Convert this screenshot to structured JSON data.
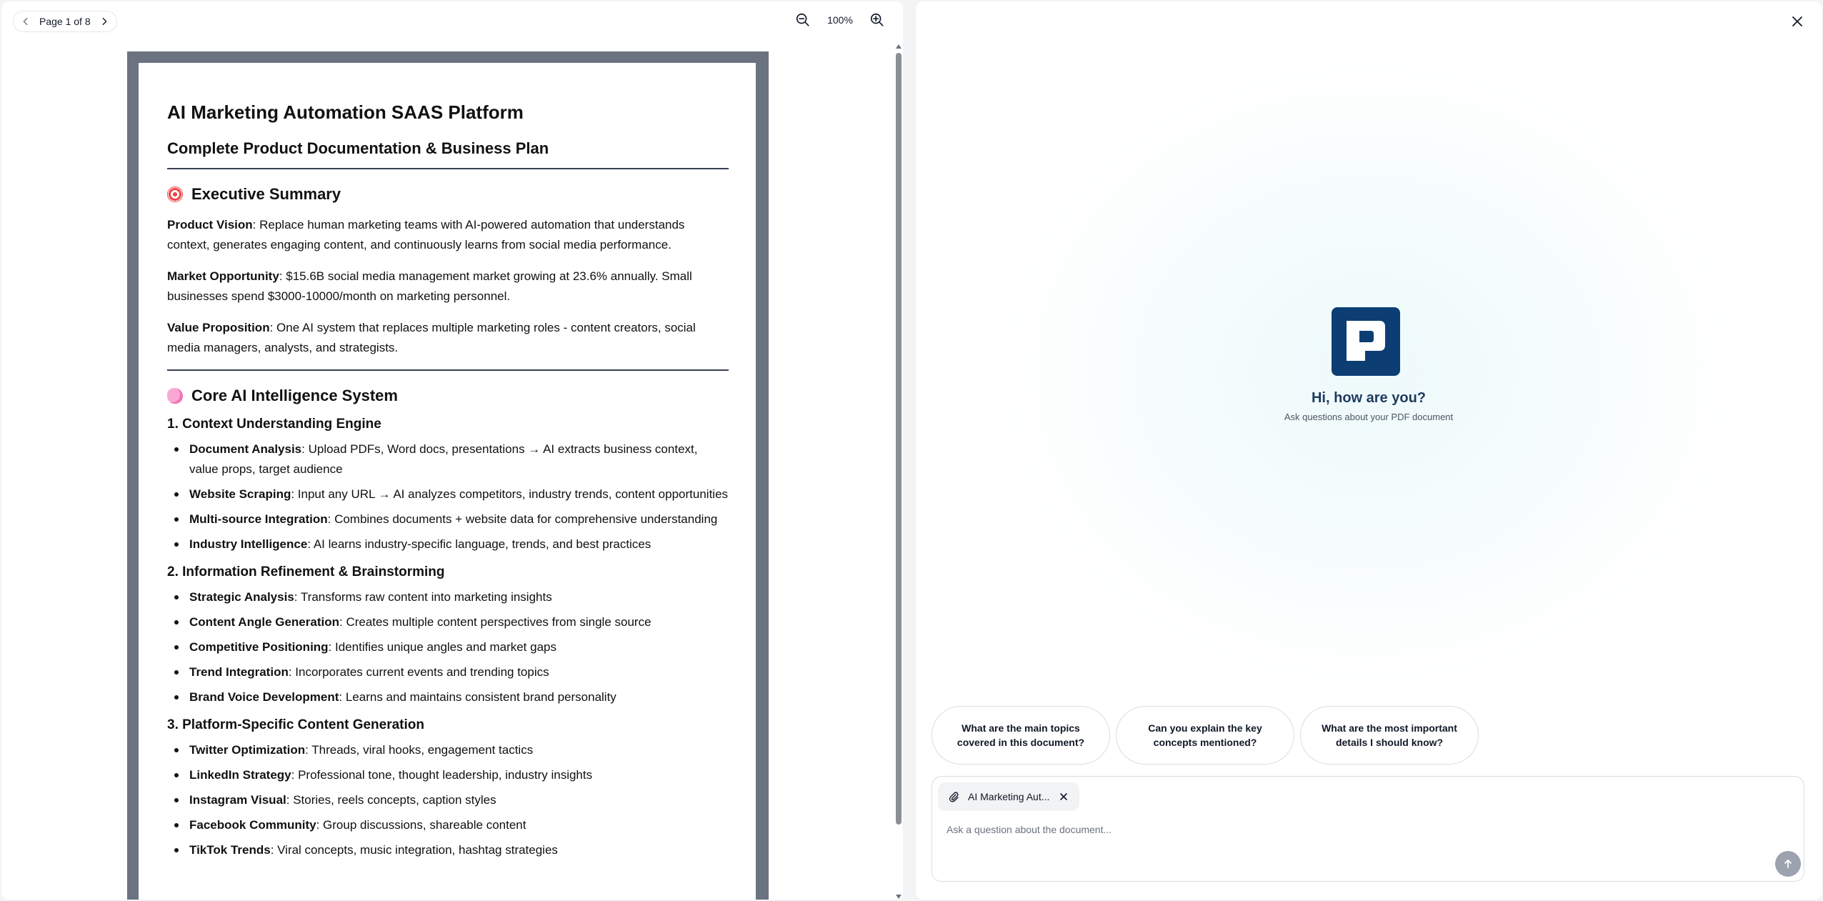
{
  "viewer": {
    "page_indicator": "Page 1 of 8",
    "zoom_level": "100%",
    "icons": {
      "prev": "chevron-left-icon",
      "next": "chevron-right-icon",
      "zoom_out": "zoom-out-icon",
      "zoom_in": "zoom-in-icon"
    }
  },
  "document": {
    "title": "AI Marketing Automation SAAS Platform",
    "subtitle": "Complete Product Documentation & Business Plan",
    "exec_summary": {
      "heading": "Executive Summary",
      "items": [
        {
          "label": "Product Vision",
          "text": ": Replace human marketing teams with AI-powered automation that understands context, generates engaging content, and continuously learns from social media performance."
        },
        {
          "label": "Market Opportunity",
          "text": ": $15.6B social media management market growing at 23.6% annually. Small businesses spend $3000-10000/month on marketing personnel."
        },
        {
          "label": "Value Proposition",
          "text": ": One AI system that replaces multiple marketing roles - content creators, social media managers, analysts, and strategists."
        }
      ]
    },
    "core_ai": {
      "heading": "Core AI Intelligence System",
      "sections": [
        {
          "title": "1. Context Understanding Engine",
          "items": [
            {
              "label": "Document Analysis",
              "text": ": Upload PDFs, Word docs, presentations → AI extracts business context, value props, target audience"
            },
            {
              "label": "Website Scraping",
              "text": ": Input any URL → AI analyzes competitors, industry trends, content opportunities"
            },
            {
              "label": "Multi-source Integration",
              "text": ": Combines documents + website data for comprehensive understanding"
            },
            {
              "label": "Industry Intelligence",
              "text": ": AI learns industry-specific language, trends, and best practices"
            }
          ]
        },
        {
          "title": "2. Information Refinement & Brainstorming",
          "items": [
            {
              "label": "Strategic Analysis",
              "text": ": Transforms raw content into marketing insights"
            },
            {
              "label": "Content Angle Generation",
              "text": ": Creates multiple content perspectives from single source"
            },
            {
              "label": "Competitive Positioning",
              "text": ": Identifies unique angles and market gaps"
            },
            {
              "label": "Trend Integration",
              "text": ": Incorporates current events and trending topics"
            },
            {
              "label": "Brand Voice Development",
              "text": ": Learns and maintains consistent brand personality"
            }
          ]
        },
        {
          "title": "3. Platform-Specific Content Generation",
          "items": [
            {
              "label": "Twitter Optimization",
              "text": ": Threads, viral hooks, engagement tactics"
            },
            {
              "label": "LinkedIn Strategy",
              "text": ": Professional tone, thought leadership, industry insights"
            },
            {
              "label": "Instagram Visual",
              "text": ": Stories, reels concepts, caption styles"
            },
            {
              "label": "Facebook Community",
              "text": ": Group discussions, shareable content"
            },
            {
              "label": "TikTok Trends",
              "text": ": Viral concepts, music integration, hashtag strategies"
            }
          ]
        }
      ]
    }
  },
  "chat": {
    "greeting": "Hi, how are you?",
    "subtitle": "Ask questions about your PDF document",
    "suggestions": [
      "What are the main topics covered in this document?",
      "Can you explain the key concepts mentioned?",
      "What are the most important details I should know?"
    ],
    "attachment_name": "AI Marketing Aut...",
    "input_placeholder": "Ask a question about the document...",
    "input_value": "",
    "colors": {
      "logo_bg": "#0c3e74",
      "send_button": "#9ca3af"
    }
  }
}
